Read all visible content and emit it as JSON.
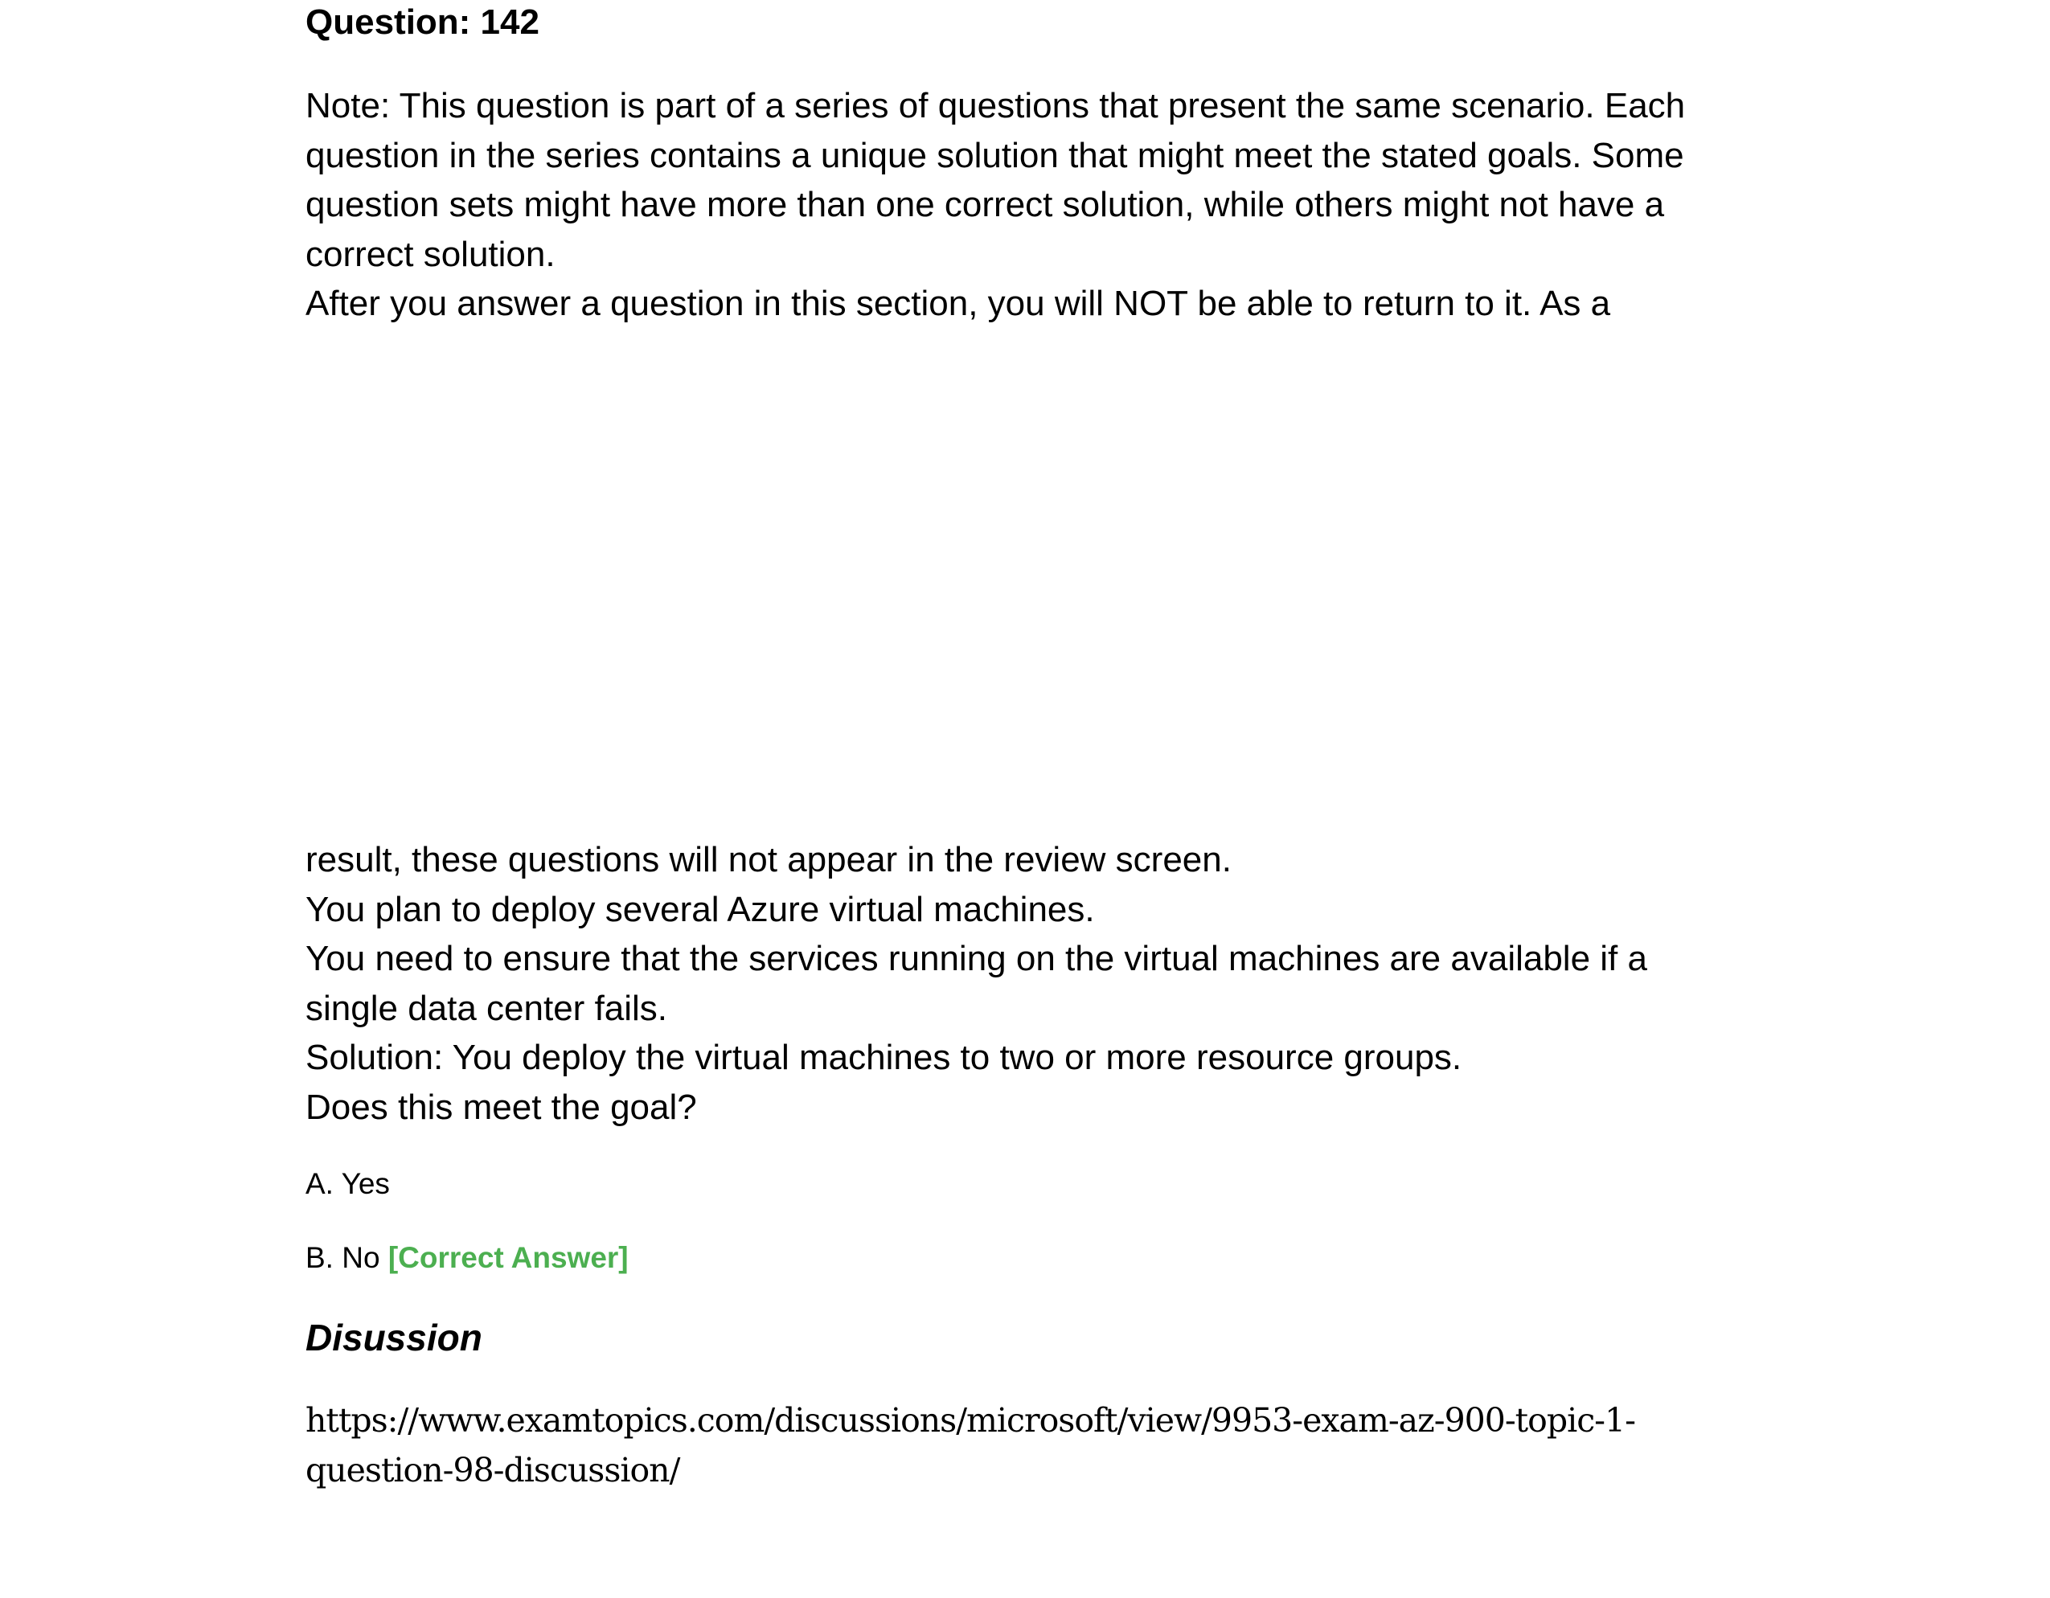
{
  "question": {
    "title": "Question: 142"
  },
  "note_lines": [
    "Note: This question is part of a series of questions that present the same scenario. Each",
    "question in the series contains a unique solution that might meet the stated goals. Some",
    "question sets might have more than one correct solution, while others might not have a",
    "correct solution.",
    "After you answer a question in this section, you will NOT be able to return to it. As a"
  ],
  "scenario_lines": [
    "result, these questions will not appear in the review screen.",
    "You plan to deploy several Azure virtual machines.",
    "You need to ensure that the services running on the virtual machines are available if a",
    "single data center fails.",
    "Solution: You deploy the virtual machines to two or more resource groups.",
    "Does this meet the goal?"
  ],
  "options": {
    "a": "A. Yes",
    "b": "B. No",
    "correct_label": "[Correct Answer]"
  },
  "discussion": {
    "heading": "Disussion",
    "link_line1": "https://www.examtopics.com/discussions/microsoft/view/9953-exam-az-900-topic-1-",
    "link_line2": "question-98-discussion/"
  },
  "colors": {
    "text": "#000000",
    "correct_answer": "#4caf50",
    "background": "#ffffff"
  }
}
